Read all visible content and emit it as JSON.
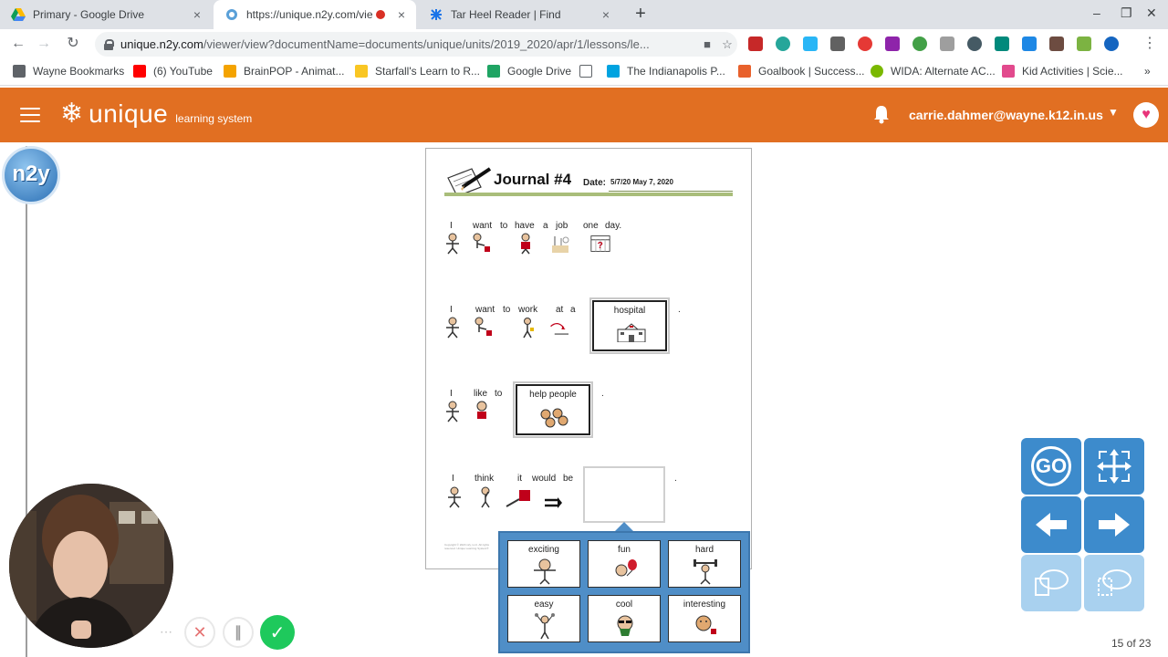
{
  "browser": {
    "tabs": [
      {
        "title": "Primary - Google Drive",
        "close": "×"
      },
      {
        "title": "https://unique.n2y.com/vie",
        "close": "×"
      },
      {
        "title": "Tar Heel Reader | Find",
        "close": "×"
      }
    ],
    "new_tab": "+",
    "window_controls": {
      "minimize": "–",
      "restore": "❐",
      "close": "✕"
    },
    "url_host": "unique.n2y.com",
    "url_path": "/viewer/view?documentName=documents/unique/units/2019_2020/apr/1/lessons/le...",
    "bookmarks": [
      {
        "label": "Wayne Bookmarks",
        "color": "#5f6368"
      },
      {
        "label": "(6) YouTube",
        "color": "#ff0000"
      },
      {
        "label": "BrainPOP - Animat...",
        "color": "#f4a300"
      },
      {
        "label": "Starfall's Learn to R...",
        "color": "#f9c623"
      },
      {
        "label": "Google Drive",
        "color": "#1fa463"
      },
      {
        "label": "",
        "color": "#5f6368"
      },
      {
        "label": "The Indianapolis P...",
        "color": "#00a3e0"
      },
      {
        "label": "Goalbook | Success...",
        "color": "#e8612c"
      },
      {
        "label": "WIDA: Alternate AC...",
        "color": "#7ab800"
      },
      {
        "label": "Kid Activities | Scie...",
        "color": "#e24a8d"
      }
    ],
    "bookmarks_more": "»"
  },
  "header": {
    "brand": "unique",
    "brand_sub": "learning system",
    "user_email": "carrie.dahmer@wayne.k12.in.us",
    "brand_color": "#e16f22"
  },
  "document": {
    "title": "Journal #4",
    "date_label": "Date:",
    "date_value": "5/7/20  May 7, 2020",
    "sentence1": [
      "I",
      "want",
      "to",
      "have",
      "a",
      "job",
      "one",
      "day."
    ],
    "sentence2": [
      "I",
      "want",
      "to",
      "work",
      "at",
      "a"
    ],
    "sentence2_choice": "hospital",
    "sentence3": [
      "I",
      "like",
      "to"
    ],
    "sentence3_choice": "help people",
    "sentence4": [
      "I",
      "think",
      "it",
      "would",
      "be"
    ],
    "period": ".",
    "copyright": "Copyright © 2020 n2y, LLC. All rights reserved. Unique Learning System®"
  },
  "options": [
    {
      "label": "exciting",
      "icon": "excited-person-icon"
    },
    {
      "label": "fun",
      "icon": "balloon-person-icon"
    },
    {
      "label": "hard",
      "icon": "weightlifter-icon"
    },
    {
      "label": "easy",
      "icon": "light-weights-icon"
    },
    {
      "label": "cool",
      "icon": "sunglasses-person-icon"
    },
    {
      "label": "interesting",
      "icon": "curious-person-icon"
    }
  ],
  "controls": {
    "go_label": "GO",
    "page_counter": "15 of 23",
    "pad_color": "#3d8bcc"
  },
  "logo_badge": "n2y"
}
